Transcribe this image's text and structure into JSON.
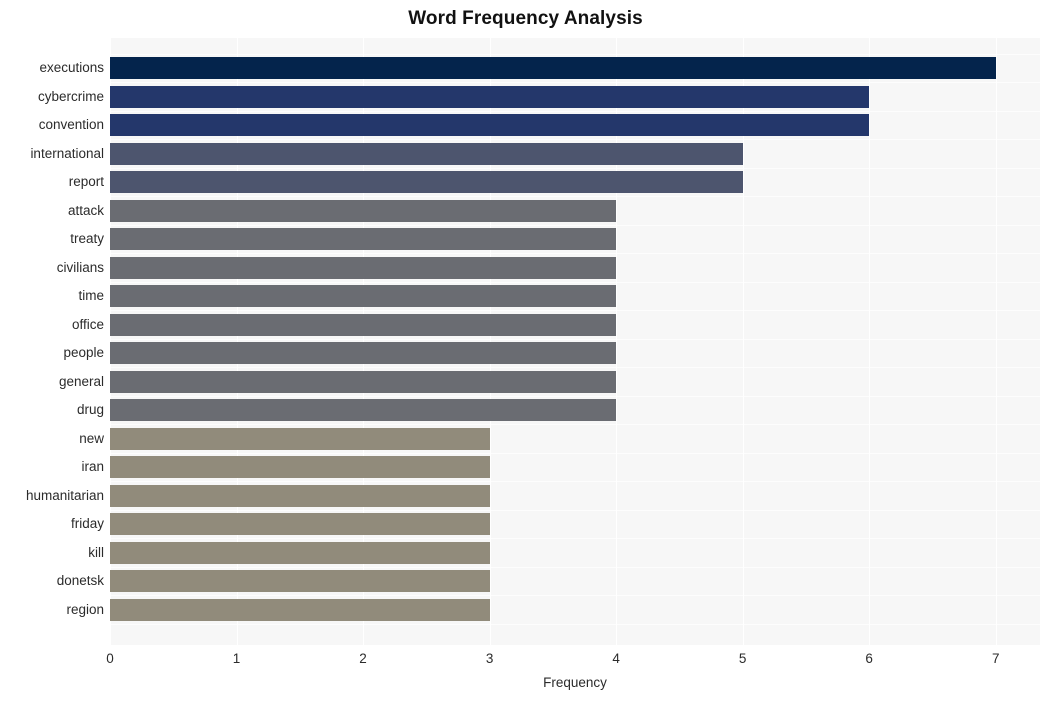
{
  "chart_data": {
    "type": "bar",
    "orientation": "horizontal",
    "title": "Word Frequency Analysis",
    "xlabel": "Frequency",
    "ylabel": "",
    "xlim": [
      0,
      7.35
    ],
    "xticks": [
      0,
      1,
      2,
      3,
      4,
      5,
      6,
      7
    ],
    "xtick_labels": [
      "0",
      "1",
      "2",
      "3",
      "4",
      "5",
      "6",
      "7"
    ],
    "grid": true,
    "legend": null,
    "categories": [
      "executions",
      "cybercrime",
      "convention",
      "international",
      "report",
      "attack",
      "treaty",
      "civilians",
      "time",
      "office",
      "people",
      "general",
      "drug",
      "new",
      "iran",
      "humanitarian",
      "friday",
      "kill",
      "donetsk",
      "region"
    ],
    "values": [
      7,
      6,
      6,
      5,
      5,
      4,
      4,
      4,
      4,
      4,
      4,
      4,
      4,
      3,
      3,
      3,
      3,
      3,
      3,
      3
    ],
    "bar_colors": [
      "#04244c",
      "#24376b",
      "#24376b",
      "#4d556e",
      "#4d556e",
      "#6a6c72",
      "#6a6c72",
      "#6a6c72",
      "#6a6c72",
      "#6a6c72",
      "#6a6c72",
      "#6a6c72",
      "#6a6c72",
      "#918b7b",
      "#918b7b",
      "#918b7b",
      "#918b7b",
      "#918b7b",
      "#918b7b",
      "#918b7b"
    ]
  },
  "style": {
    "figure_background": "#ffffff",
    "plot_background": "#f7f7f7",
    "gridline_color": "#ffffff",
    "text_color": "#2b2b2b",
    "title_color": "#111111"
  }
}
